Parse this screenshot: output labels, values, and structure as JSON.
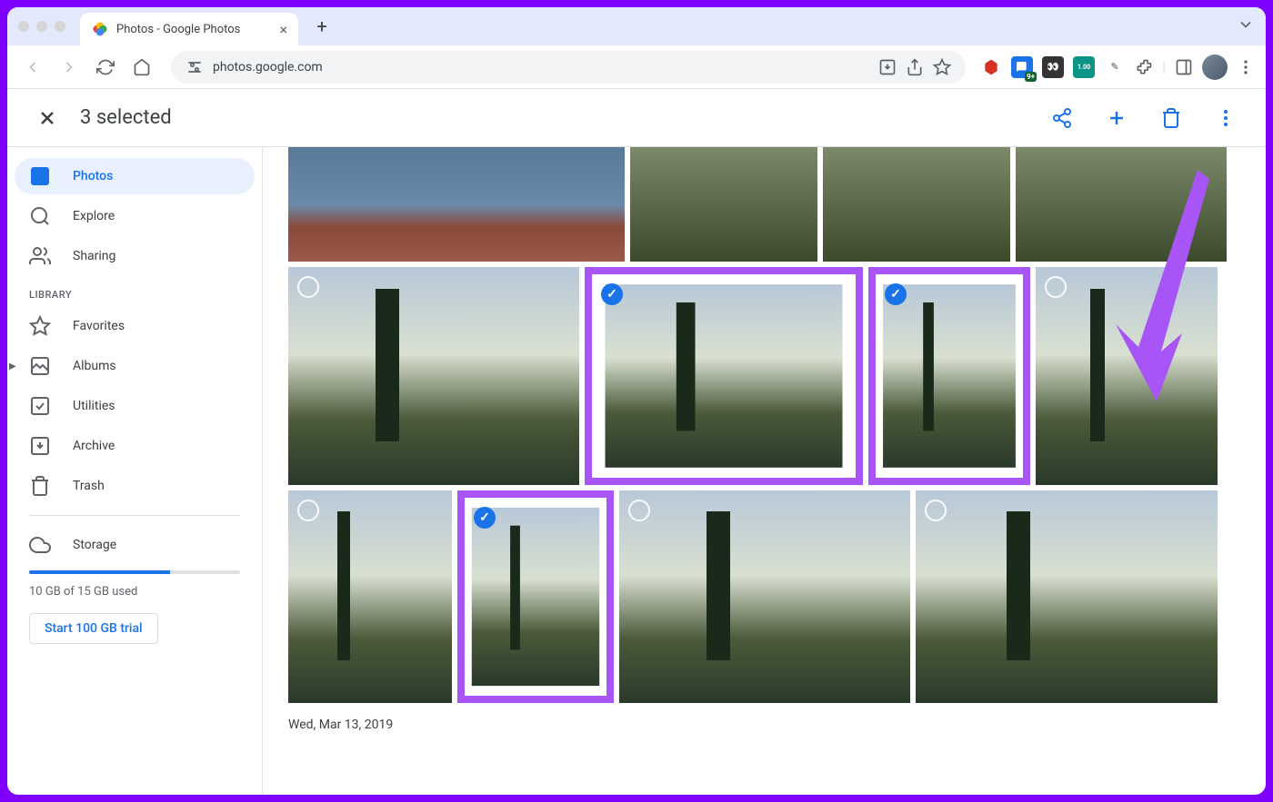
{
  "browser": {
    "tab_title": "Photos - Google Photos",
    "url": "photos.google.com",
    "ext_badge_1": "9+",
    "ext_badge_2": "1.00"
  },
  "selection": {
    "count_text": "3 selected"
  },
  "sidebar": {
    "items": [
      {
        "label": "Photos",
        "icon": "image-icon",
        "active": true
      },
      {
        "label": "Explore",
        "icon": "search-icon"
      },
      {
        "label": "Sharing",
        "icon": "people-icon"
      }
    ],
    "library_label": "LIBRARY",
    "library_items": [
      {
        "label": "Favorites",
        "icon": "star-icon"
      },
      {
        "label": "Albums",
        "icon": "album-icon",
        "has_expand": true
      },
      {
        "label": "Utilities",
        "icon": "checkbox-icon"
      },
      {
        "label": "Archive",
        "icon": "archive-icon"
      },
      {
        "label": "Trash",
        "icon": "trash-icon"
      }
    ],
    "storage": {
      "label": "Storage",
      "used_text": "10 GB of 15 GB used",
      "percent": 67,
      "trial_label": "Start 100 GB trial"
    }
  },
  "content": {
    "date_label": "Wed, Mar 13, 2019"
  },
  "colors": {
    "accent": "#1a73e8",
    "highlight": "#a855f7"
  }
}
